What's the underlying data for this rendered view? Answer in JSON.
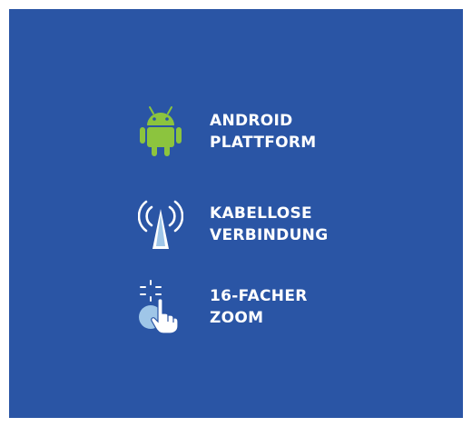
{
  "features": [
    {
      "icon": "android-robot-icon",
      "icon_color": "#8cc43e",
      "line1": "ANDROID",
      "line2": "PLATTFORM"
    },
    {
      "icon": "wireless-antenna-icon",
      "icon_color": "#ffffff",
      "line1": "KABELLOSE",
      "line2": "VERBINDUNG"
    },
    {
      "icon": "pinch-zoom-hand-icon",
      "icon_color": "#ffffff",
      "line1": "16-FACHER",
      "line2": "ZOOM"
    }
  ],
  "colors": {
    "background": "#2a55a5",
    "text": "#ffffff"
  }
}
